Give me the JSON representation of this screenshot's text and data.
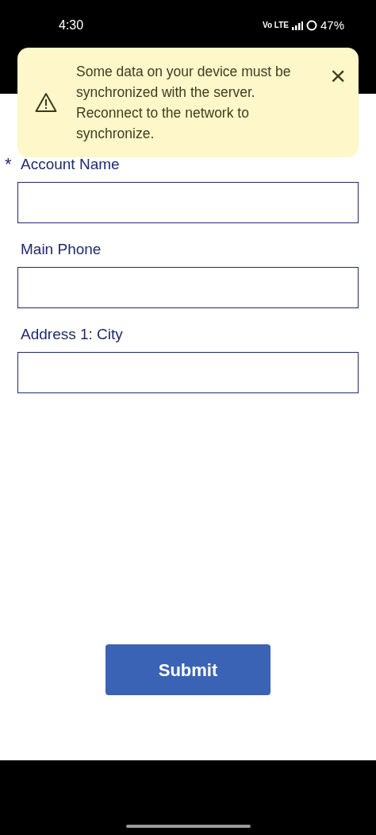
{
  "status_bar": {
    "time": "4:30",
    "network_label": "Vo LTE",
    "battery": "47%"
  },
  "banner": {
    "message": "Some data on your device must be synchronized with the server. Reconnect to the network to synchronize.",
    "close": "×"
  },
  "form": {
    "fields": [
      {
        "label": "Account Name",
        "required_mark": "*"
      },
      {
        "label": "Main Phone"
      },
      {
        "label": "Address 1: City"
      }
    ]
  },
  "submit": "Submit"
}
